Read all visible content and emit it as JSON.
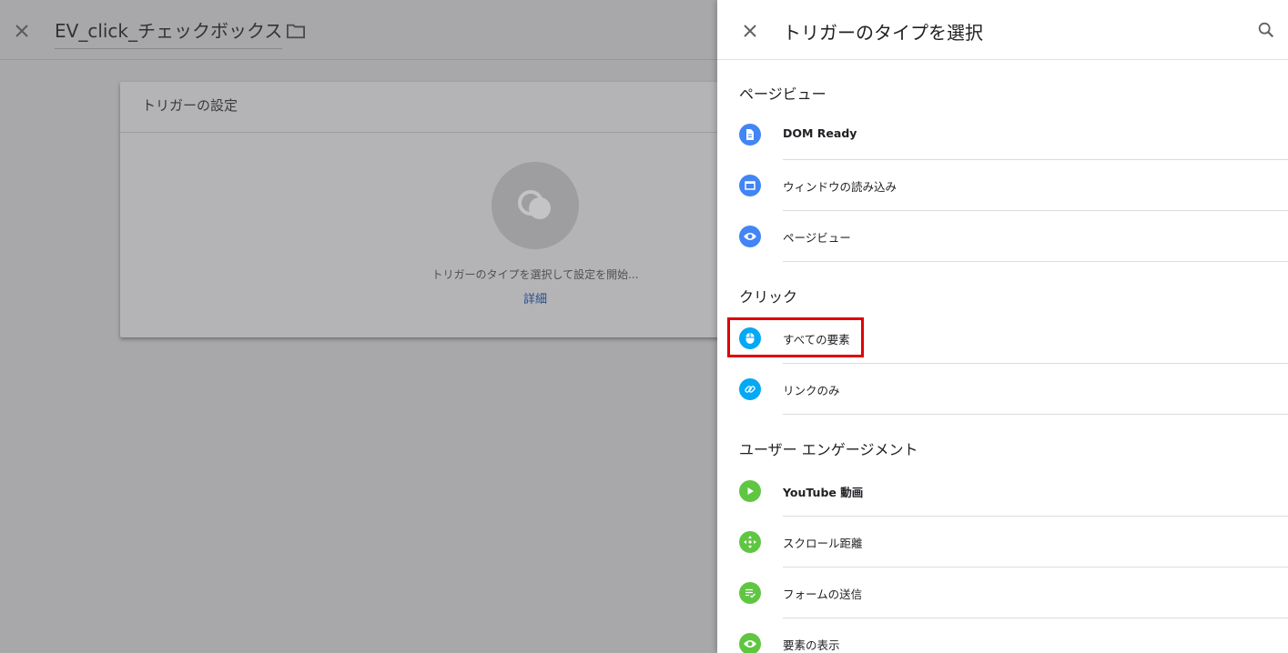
{
  "background": {
    "title": "EV_click_チェックボックス",
    "card": {
      "title": "トリガーの設定",
      "prompt": "トリガーのタイプを選択して設定を開始...",
      "link": "詳細"
    }
  },
  "panel": {
    "title": "トリガーのタイプを選択",
    "sections": [
      {
        "title": "ページビュー",
        "items": [
          {
            "label": "DOM Ready",
            "icon": "document-icon",
            "color": "#4285f4"
          },
          {
            "label": "ウィンドウの読み込み",
            "icon": "window-icon",
            "color": "#4285f4"
          },
          {
            "label": "ページビュー",
            "icon": "eye-icon",
            "color": "#4285f4"
          }
        ]
      },
      {
        "title": "クリック",
        "items": [
          {
            "label": "すべての要素",
            "icon": "mouse-icon",
            "color": "#03a9f4",
            "highlighted": true
          },
          {
            "label": "リンクのみ",
            "icon": "link-icon",
            "color": "#03a9f4"
          }
        ]
      },
      {
        "title": "ユーザー エンゲージメント",
        "items": [
          {
            "label": "YouTube 動画",
            "icon": "play-icon",
            "color": "#5fc642"
          },
          {
            "label": "スクロール距離",
            "icon": "move-icon",
            "color": "#5fc642"
          },
          {
            "label": "フォームの送信",
            "icon": "form-check-icon",
            "color": "#5fc642"
          },
          {
            "label": "要素の表示",
            "icon": "eye-icon",
            "color": "#5fc642"
          }
        ]
      }
    ]
  },
  "colors": {
    "highlight": "#e00000",
    "link": "#2a4e8c"
  }
}
